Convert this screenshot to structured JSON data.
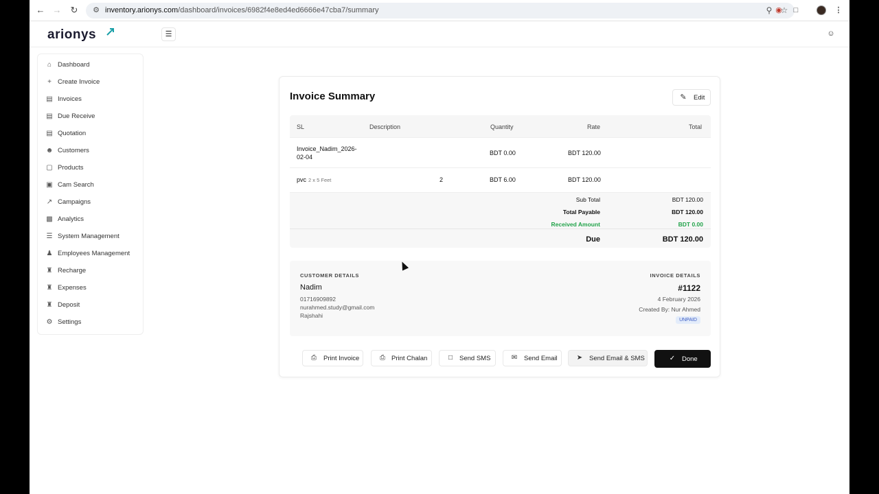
{
  "browser": {
    "url_host": "inventory.arionys.com",
    "url_path": "/dashboard/invoices/6982f4e8ed4ed6666e47cba7/summary"
  },
  "app": {
    "logo": "arionys"
  },
  "sidebar": {
    "items": [
      {
        "label": "Dashboard",
        "icon": "home-icon"
      },
      {
        "label": "Create Invoice",
        "icon": "plus-icon"
      },
      {
        "label": "Invoices",
        "icon": "document-icon"
      },
      {
        "label": "Due Receive",
        "icon": "document-icon"
      },
      {
        "label": "Quotation",
        "icon": "document-icon"
      },
      {
        "label": "Customers",
        "icon": "users-icon"
      },
      {
        "label": "Products",
        "icon": "bag-icon"
      },
      {
        "label": "Cam Search",
        "icon": "scan-icon"
      },
      {
        "label": "Campaigns",
        "icon": "trend-icon"
      },
      {
        "label": "Analytics",
        "icon": "chart-icon"
      },
      {
        "label": "System Management",
        "icon": "server-icon"
      },
      {
        "label": "Employees Management",
        "icon": "team-icon"
      },
      {
        "label": "Recharge",
        "icon": "bank-icon"
      },
      {
        "label": "Expenses",
        "icon": "bank-icon"
      },
      {
        "label": "Deposit",
        "icon": "bank-icon"
      },
      {
        "label": "Settings",
        "icon": "gear-icon"
      }
    ]
  },
  "summary": {
    "title": "Invoice Summary",
    "edit_label": "Edit",
    "columns": [
      "SL",
      "Description",
      "Quantity",
      "Rate",
      "Total"
    ],
    "rows": [
      {
        "sl": "Invoice_Nadim_2026-02-04",
        "description": "",
        "quantity": "",
        "rate": "BDT 0.00",
        "total": "BDT 120.00",
        "sub": ""
      },
      {
        "sl": "pvc",
        "sub": "2 x 5 Feet",
        "description": "2",
        "quantity": "",
        "rate": "BDT 6.00",
        "total": "BDT 120.00"
      }
    ],
    "totals": {
      "subtotal_label": "Sub Total",
      "subtotal": "BDT 120.00",
      "payable_label": "Total Payable",
      "payable": "BDT 120.00",
      "received_label": "Received Amount",
      "received": "BDT 0.00",
      "due_label": "Due",
      "due": "BDT 120.00"
    }
  },
  "customer": {
    "heading": "CUSTOMER DETAILS",
    "name": "Nadim",
    "phone": "01716909892",
    "email": "nurahmed.study@gmail.com",
    "city": "Rajshahi"
  },
  "invoice": {
    "heading": "INVOICE DETAILS",
    "number": "#1122",
    "date": "4 February 2026",
    "created_by": "Created By: Nur Ahmed",
    "status": "UNPAID"
  },
  "actions": {
    "print_invoice": "Print Invoice",
    "print_chalan": "Print Chalan",
    "send_sms": "Send SMS",
    "send_email": "Send Email",
    "send_email_sms": "Send Email & SMS",
    "done": "Done"
  },
  "colors": {
    "accent": "#111111",
    "green": "#22a34a",
    "badge": "#3b5cc4"
  }
}
